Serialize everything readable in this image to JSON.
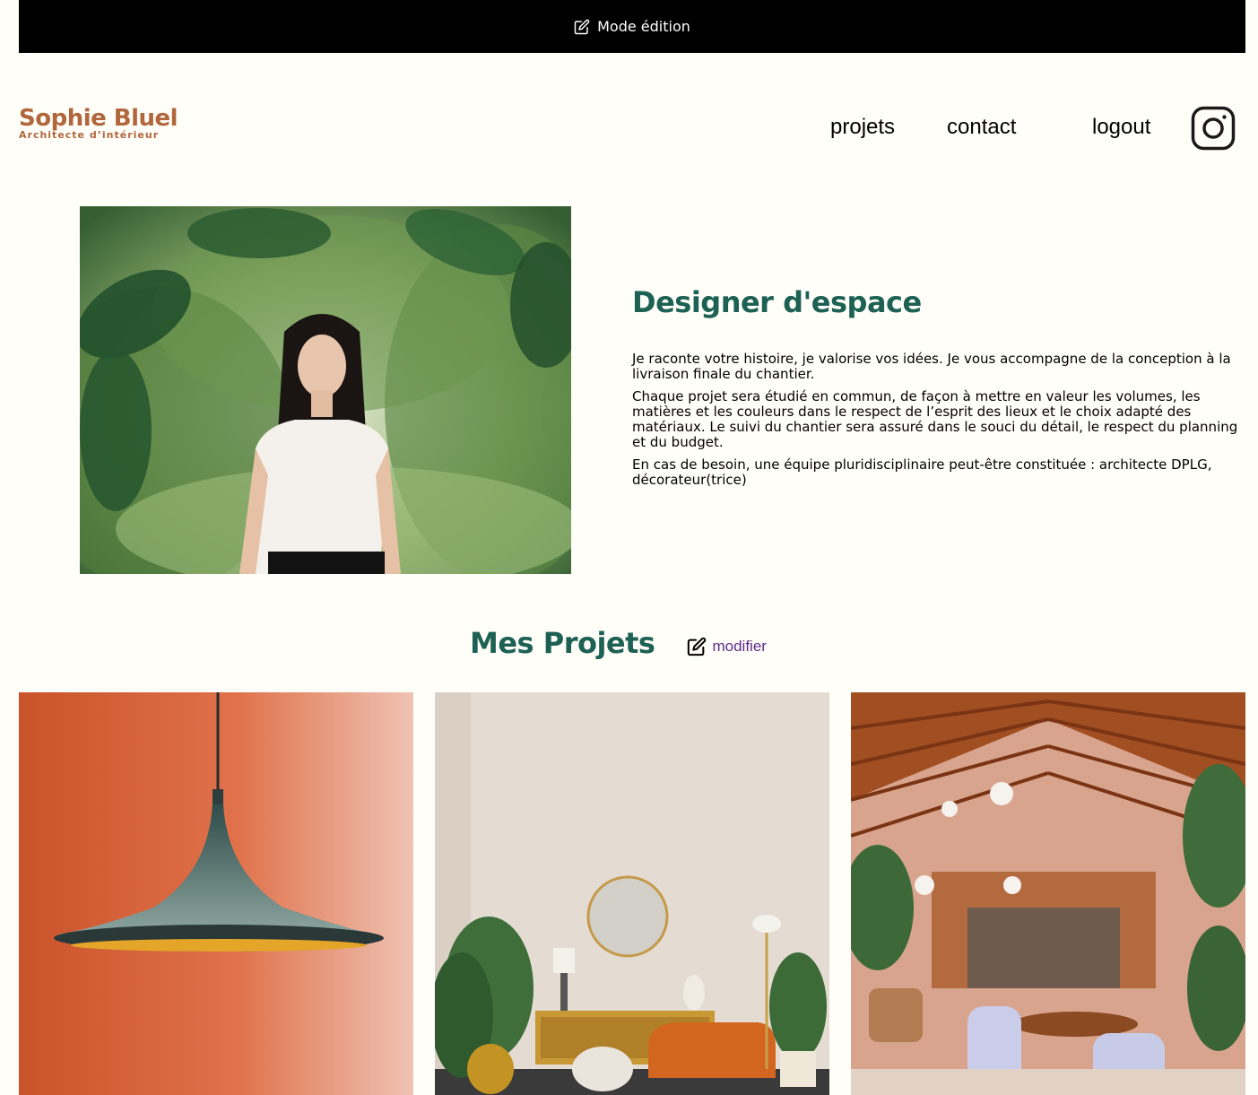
{
  "edit_bar": {
    "label": "Mode édition",
    "icon": "pen-to-square-icon"
  },
  "header": {
    "logo_title": "Sophie Bluel",
    "logo_subtitle": "Architecte d’intérieur",
    "nav": {
      "projets": "projets",
      "contact": "contact",
      "logout": "logout"
    },
    "instagram_icon": "instagram-icon"
  },
  "intro": {
    "title": "Designer d'espace",
    "paragraphs": [
      "Je raconte votre histoire, je valorise vos idées. Je vous accompagne de la conception à la livraison finale du chantier.",
      "Chaque projet sera étudié en commun, de façon à mettre en valeur les volumes, les matières et les couleurs dans le respect de l’esprit des lieux et le choix adapté des matériaux. Le suivi du chantier sera assuré dans le souci du détail, le respect du planning et du budget.",
      "En cas de besoin, une équipe pluridisciplinaire peut-être constituée : architecte DPLG, décorateur(trice)"
    ]
  },
  "projects": {
    "title": "Mes Projets",
    "modify_label": "modifier"
  },
  "colors": {
    "brand": "#B1663C",
    "accent": "#1D6154",
    "background": "#FFFEF8",
    "link": "#5C2B8A"
  }
}
